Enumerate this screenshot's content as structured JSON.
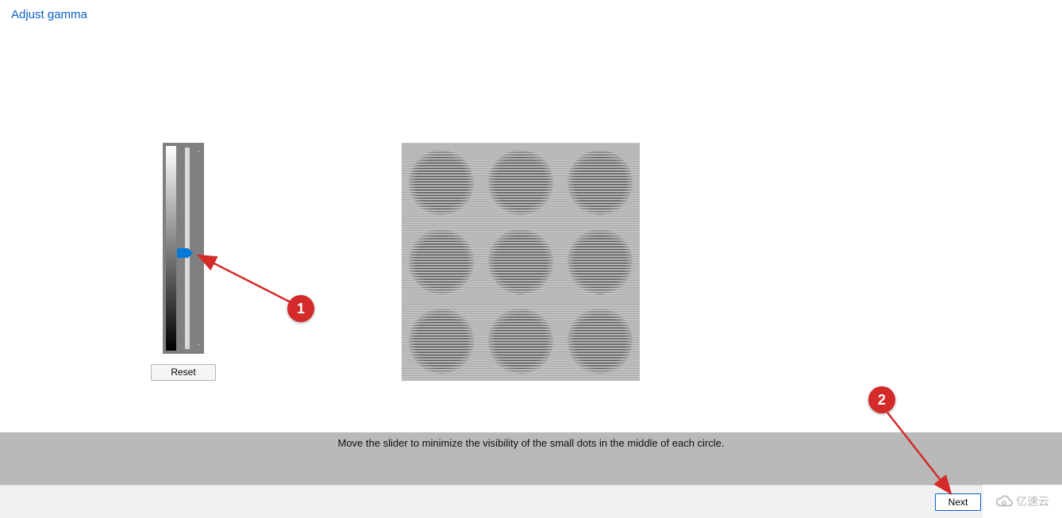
{
  "title": "Adjust gamma",
  "slider": {
    "reset_label": "Reset",
    "tick_top": "-",
    "tick_bottom": "-"
  },
  "instruction": "Move the slider to minimize the visibility of the small dots in the middle of each circle.",
  "nav": {
    "next_label": "Next"
  },
  "annotations": {
    "badge1": "1",
    "badge2": "2"
  },
  "watermark": "亿速云"
}
